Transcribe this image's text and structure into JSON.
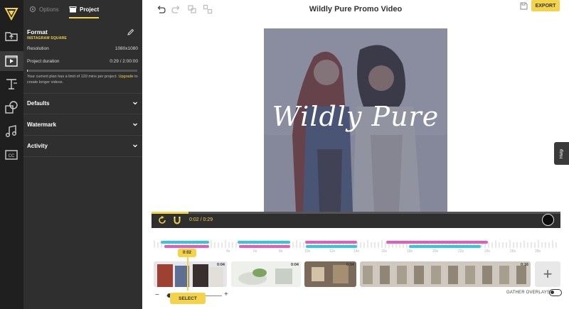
{
  "sidebar": {
    "tabs": [
      {
        "label": "Options",
        "icon": "gear-icon"
      },
      {
        "label": "Project",
        "icon": "clapperboard-icon"
      }
    ],
    "format": {
      "title": "Format",
      "subtitle": "INSTAGRAM SQUARE",
      "resolution_label": "Resolution",
      "resolution_value": "1080x1080",
      "duration_label": "Project duration",
      "duration_value": "0:29 / 2:00:00",
      "duration_progress": 0.004,
      "note_text": "Your current plan has a limit of 120 mins per project.",
      "note_link": "Upgrade",
      "note_tail": "to create longer videos."
    },
    "sections": [
      {
        "label": "Defaults"
      },
      {
        "label": "Watermark"
      },
      {
        "label": "Activity"
      }
    ]
  },
  "rail_icons": [
    "logo-icon",
    "folder-upload-icon",
    "media-icon",
    "text-icon",
    "shapes-icon",
    "music-icon",
    "captions-icon"
  ],
  "header": {
    "title": "Wildly Pure Promo Video",
    "export_label": "EXPORT"
  },
  "canvas": {
    "overlay_text": "Wildly Pure"
  },
  "help_label": "Help",
  "player": {
    "current_time": "0:02",
    "total_time": "0:29",
    "progress": 0.09
  },
  "timeline": {
    "playhead_label": "0:02",
    "ruler_labels": [
      "2s",
      "4s",
      "6s",
      "8s",
      "10s",
      "12s",
      "14s",
      "16s",
      "18s",
      "20s",
      "22s",
      "24s",
      "26s",
      "28s"
    ],
    "clips": [
      {
        "duration": "0:04"
      },
      {
        "duration": "0:04"
      },
      {
        "duration": "0:04"
      },
      {
        "duration": "0:16"
      }
    ],
    "select_label": "SELECT",
    "gather_label": "GATHER OVERLAYS",
    "gather_on": false
  },
  "colors": {
    "accent": "#f3d34a",
    "panel": "#2f2f2f",
    "overlay_cyan": "#34c5e0",
    "overlay_pink": "#e05dc0"
  }
}
